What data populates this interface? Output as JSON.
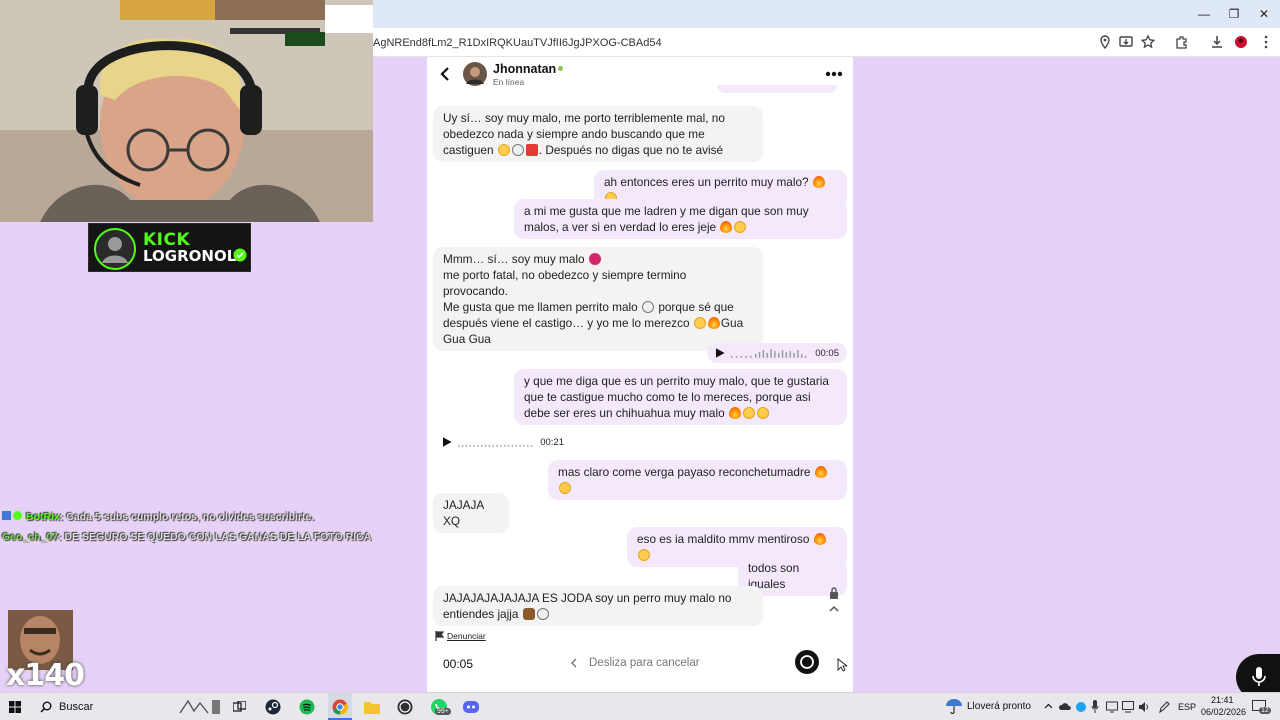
{
  "browser": {
    "url": "AgNREnd8fLm2_R1DxIRQKUauTVJfII6JgJPXOG-CBAd54"
  },
  "stream_overlay": {
    "kick_logo": "KICK",
    "streamer_name": "LOGRONOL",
    "chat": [
      {
        "user": "BotRix",
        "message": ": Cada 5 subs cumplo retos, no olvides suscribirte."
      },
      {
        "user": "Geo_ch_07",
        "message": ": DE SEGURO SE QUEDO CON LAS GANAS DE LA FOTO RICA"
      }
    ],
    "multiplier": "x140"
  },
  "chat": {
    "contact_name": "Jhonnatan",
    "contact_status": "En línea",
    "messages": [
      {
        "dir": "in",
        "text": "Uy sí… soy muy malo, me porto terriblemente mal, no obedezco nada y siempre ando buscando que me castiguen",
        "tail": ". Después no digas que no te avisé"
      },
      {
        "dir": "out",
        "text": "ah entonces eres un perrito muy malo?"
      },
      {
        "dir": "out",
        "text": "a mi me gusta que me ladren y me digan que son muy malos, a ver si en verdad lo eres jeje"
      },
      {
        "dir": "in",
        "line1": "Mmm… sí… soy muy malo",
        "line2": "me porto fatal, no obedezco y siempre termino provocando.",
        "line3": "Me gusta que me llamen perrito malo",
        "line3b": "porque sé que",
        "line4": "después viene el castigo… y yo me lo merezco",
        "line4b": "Gua",
        "line5": "Gua Gua"
      },
      {
        "dir": "out",
        "type": "audio",
        "duration": "00:05"
      },
      {
        "dir": "out",
        "text": "y que me diga que es un perrito muy malo, que te gustaria que te castigue mucho como te lo mereces, porque asi debe ser eres un chihuahua muy malo"
      },
      {
        "dir": "in",
        "type": "audio",
        "duration": "00:21"
      },
      {
        "dir": "out",
        "text": "mas claro come verga payaso reconchetumadre"
      },
      {
        "dir": "in",
        "text": "JAJAJA XQ"
      },
      {
        "dir": "out",
        "text": "eso es ia maldito mmv mentiroso"
      },
      {
        "dir": "out",
        "text": "todos son iguales"
      },
      {
        "dir": "in",
        "text": "JAJAJAJAJAJAJA ES JODA soy un perro muy malo no entiendes jajja"
      }
    ],
    "report_label": "Denunciar",
    "recording": {
      "timer": "00:05",
      "cancel_hint": "Desliza para cancelar"
    }
  },
  "taskbar": {
    "search_placeholder": "Buscar",
    "whatsapp_badge": "99+",
    "weather": "Lloverá pronto",
    "lang": "ESP",
    "time": "21:41",
    "date": "06/02/2026",
    "notif_count": "12"
  },
  "colors": {
    "page_bg": "#e6d2f6",
    "out_bubble": "#f4e9fb",
    "in_bubble": "#f3f3f3",
    "kick_green": "#53fc18"
  }
}
